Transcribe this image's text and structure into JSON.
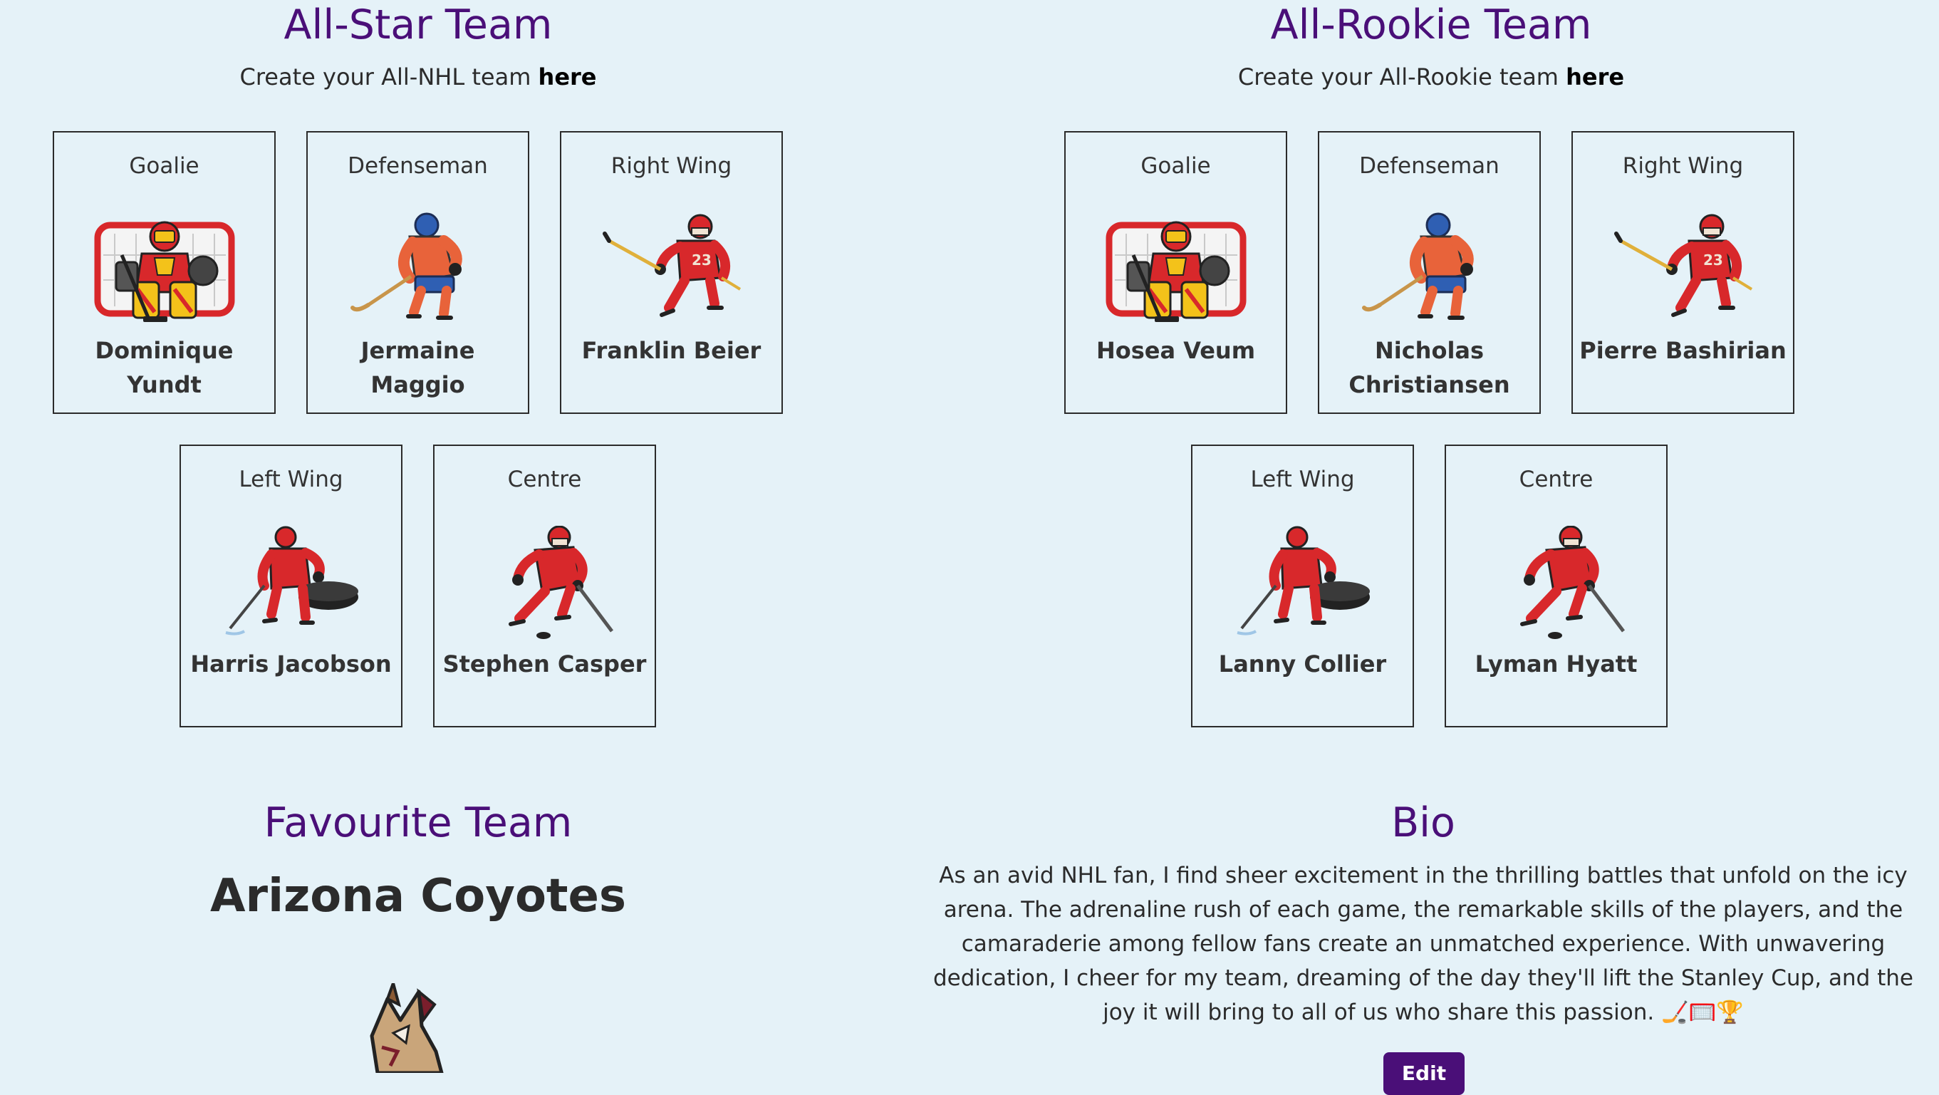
{
  "all_star": {
    "title": "All-Star Team",
    "subtitle_prefix": "Create your All-NHL team ",
    "subtitle_link": "here",
    "cards": [
      {
        "position": "Goalie",
        "name": "Dominique Yundt",
        "art": "goalie-icon"
      },
      {
        "position": "Defenseman",
        "name": "Jermaine Maggio",
        "art": "defenseman-icon"
      },
      {
        "position": "Right Wing",
        "name": "Franklin Beier",
        "art": "right-wing-icon"
      },
      {
        "position": "Left Wing",
        "name": "Harris Jacobson",
        "art": "left-wing-icon"
      },
      {
        "position": "Centre",
        "name": "Stephen Casper",
        "art": "centre-icon"
      }
    ]
  },
  "all_rookie": {
    "title": "All-Rookie Team",
    "subtitle_prefix": "Create your All-Rookie team ",
    "subtitle_link": "here",
    "cards": [
      {
        "position": "Goalie",
        "name": "Hosea Veum",
        "art": "goalie-icon"
      },
      {
        "position": "Defenseman",
        "name": "Nicholas Christiansen",
        "art": "defenseman-icon"
      },
      {
        "position": "Right Wing",
        "name": "Pierre Bashirian",
        "art": "right-wing-icon"
      },
      {
        "position": "Left Wing",
        "name": "Lanny Collier",
        "art": "left-wing-icon"
      },
      {
        "position": "Centre",
        "name": "Lyman Hyatt",
        "art": "centre-icon"
      }
    ]
  },
  "favourite": {
    "title": "Favourite Team",
    "team": "Arizona Coyotes",
    "logo_icon": "coyote-logo-icon"
  },
  "bio": {
    "title": "Bio",
    "text": "As an avid NHL fan, I find sheer excitement in the thrilling battles that unfold on the icy arena. The adrenaline rush of each game, the remarkable skills of the players, and the camaraderie among fellow fans create an unmatched experience. With unwavering dedication, I cheer for my team, dreaming of the day they'll lift the Stanley Cup, and the joy it will bring to all of us who share this passion. 🏒🥅🏆",
    "edit_label": "Edit"
  },
  "colors": {
    "background": "#e5f2f8",
    "accent": "#4a0f78",
    "jersey_red": "#d8282b",
    "jersey_orange": "#e8633a",
    "helmet_blue": "#2f5fb3"
  }
}
